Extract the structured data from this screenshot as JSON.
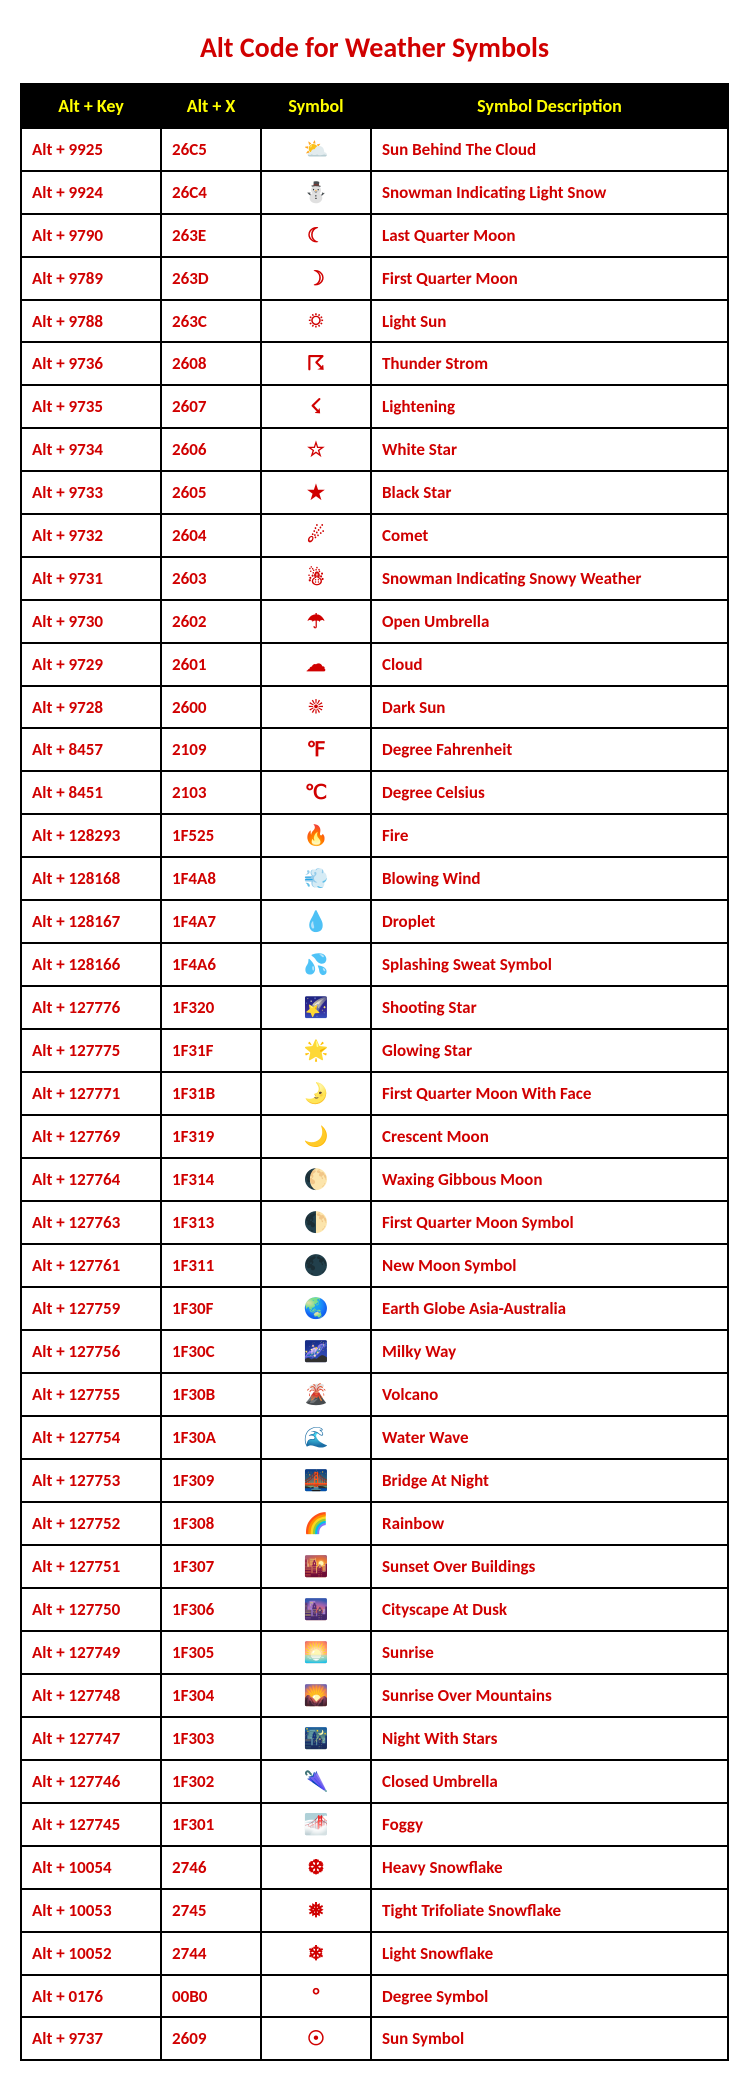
{
  "title": "Alt Code for Weather Symbols",
  "headers": [
    "Alt + Key",
    "Alt + X",
    "Symbol",
    "Symbol Description"
  ],
  "rows": [
    {
      "alt_key": "Alt + 9925",
      "alt_x": "26C5",
      "symbol": "⛅",
      "desc": "Sun Behind The Cloud"
    },
    {
      "alt_key": "Alt + 9924",
      "alt_x": "26C4",
      "symbol": "⛄",
      "desc": "Snowman Indicating Light Snow"
    },
    {
      "alt_key": "Alt + 9790",
      "alt_x": "263E",
      "symbol": "☾",
      "desc": "Last Quarter Moon"
    },
    {
      "alt_key": "Alt + 9789",
      "alt_x": "263D",
      "symbol": "☽",
      "desc": "First Quarter Moon"
    },
    {
      "alt_key": "Alt + 9788",
      "alt_x": "263C",
      "symbol": "☼",
      "desc": "Light Sun"
    },
    {
      "alt_key": "Alt + 9736",
      "alt_x": "2608",
      "symbol": "☈",
      "desc": "Thunder Strom"
    },
    {
      "alt_key": "Alt + 9735",
      "alt_x": "2607",
      "symbol": "☇",
      "desc": "Lightening"
    },
    {
      "alt_key": "Alt + 9734",
      "alt_x": "2606",
      "symbol": "☆",
      "desc": "White Star"
    },
    {
      "alt_key": "Alt + 9733",
      "alt_x": "2605",
      "symbol": "★",
      "desc": "Black Star"
    },
    {
      "alt_key": "Alt + 9732",
      "alt_x": "2604",
      "symbol": "☄",
      "desc": "Comet"
    },
    {
      "alt_key": "Alt + 9731",
      "alt_x": "2603",
      "symbol": "☃",
      "desc": "Snowman Indicating Snowy Weather"
    },
    {
      "alt_key": "Alt + 9730",
      "alt_x": "2602",
      "symbol": "☂",
      "desc": "Open Umbrella"
    },
    {
      "alt_key": "Alt + 9729",
      "alt_x": "2601",
      "symbol": "☁",
      "desc": "Cloud"
    },
    {
      "alt_key": "Alt + 9728",
      "alt_x": "2600",
      "symbol": "☀",
      "desc": "Dark Sun"
    },
    {
      "alt_key": "Alt + 8457",
      "alt_x": "2109",
      "symbol": "℉",
      "desc": "Degree Fahrenheit"
    },
    {
      "alt_key": "Alt + 8451",
      "alt_x": "2103",
      "symbol": "℃",
      "desc": "Degree Celsius"
    },
    {
      "alt_key": "Alt + 128293",
      "alt_x": "1F525",
      "symbol": "🔥",
      "desc": "Fire"
    },
    {
      "alt_key": "Alt + 128168",
      "alt_x": "1F4A8",
      "symbol": "💨",
      "desc": "Blowing Wind"
    },
    {
      "alt_key": "Alt + 128167",
      "alt_x": "1F4A7",
      "symbol": "💧",
      "desc": "Droplet"
    },
    {
      "alt_key": "Alt + 128166",
      "alt_x": "1F4A6",
      "symbol": "💦",
      "desc": "Splashing Sweat Symbol"
    },
    {
      "alt_key": "Alt + 127776",
      "alt_x": "1F320",
      "symbol": "🌠",
      "desc": "Shooting Star"
    },
    {
      "alt_key": "Alt + 127775",
      "alt_x": "1F31F",
      "symbol": "🌟",
      "desc": "Glowing Star"
    },
    {
      "alt_key": "Alt + 127771",
      "alt_x": "1F31B",
      "symbol": "🌛",
      "desc": "First Quarter Moon With Face"
    },
    {
      "alt_key": "Alt + 127769",
      "alt_x": "1F319",
      "symbol": "🌙",
      "desc": "Crescent Moon"
    },
    {
      "alt_key": "Alt + 127764",
      "alt_x": "1F314",
      "symbol": "🌔",
      "desc": "Waxing Gibbous Moon"
    },
    {
      "alt_key": "Alt + 127763",
      "alt_x": "1F313",
      "symbol": "🌓",
      "desc": "First Quarter Moon Symbol"
    },
    {
      "alt_key": "Alt + 127761",
      "alt_x": "1F311",
      "symbol": "🌑",
      "desc": "New Moon Symbol"
    },
    {
      "alt_key": "Alt + 127759",
      "alt_x": "1F30F",
      "symbol": "🌏",
      "desc": "Earth Globe Asia-Australia"
    },
    {
      "alt_key": "Alt + 127756",
      "alt_x": "1F30C",
      "symbol": "🌌",
      "desc": "Milky Way"
    },
    {
      "alt_key": "Alt + 127755",
      "alt_x": "1F30B",
      "symbol": "🌋",
      "desc": "Volcano"
    },
    {
      "alt_key": "Alt + 127754",
      "alt_x": "1F30A",
      "symbol": "🌊",
      "desc": "Water Wave"
    },
    {
      "alt_key": "Alt + 127753",
      "alt_x": "1F309",
      "symbol": "🌉",
      "desc": "Bridge At Night"
    },
    {
      "alt_key": "Alt + 127752",
      "alt_x": "1F308",
      "symbol": "🌈",
      "desc": "Rainbow"
    },
    {
      "alt_key": "Alt + 127751",
      "alt_x": "1F307",
      "symbol": "🌇",
      "desc": "Sunset Over Buildings"
    },
    {
      "alt_key": "Alt + 127750",
      "alt_x": "1F306",
      "symbol": "🌆",
      "desc": "Cityscape At Dusk"
    },
    {
      "alt_key": "Alt + 127749",
      "alt_x": "1F305",
      "symbol": "🌅",
      "desc": "Sunrise"
    },
    {
      "alt_key": "Alt + 127748",
      "alt_x": "1F304",
      "symbol": "🌄",
      "desc": "Sunrise Over Mountains"
    },
    {
      "alt_key": "Alt + 127747",
      "alt_x": "1F303",
      "symbol": "🌃",
      "desc": "Night With Stars"
    },
    {
      "alt_key": "Alt + 127746",
      "alt_x": "1F302",
      "symbol": "🌂",
      "desc": "Closed Umbrella"
    },
    {
      "alt_key": "Alt + 127745",
      "alt_x": "1F301",
      "symbol": "🌁",
      "desc": "Foggy"
    },
    {
      "alt_key": "Alt + 10054",
      "alt_x": "2746",
      "symbol": "❆",
      "desc": "Heavy Snowflake"
    },
    {
      "alt_key": "Alt + 10053",
      "alt_x": "2745",
      "symbol": "❅",
      "desc": "Tight Trifoliate Snowflake"
    },
    {
      "alt_key": "Alt + 10052",
      "alt_x": "2744",
      "symbol": "❄",
      "desc": "Light Snowflake"
    },
    {
      "alt_key": "Alt + 0176",
      "alt_x": "00B0",
      "symbol": "°",
      "desc": "Degree Symbol"
    },
    {
      "alt_key": "Alt + 9737",
      "alt_x": "2609",
      "symbol": "☉",
      "desc": "Sun Symbol"
    }
  ]
}
